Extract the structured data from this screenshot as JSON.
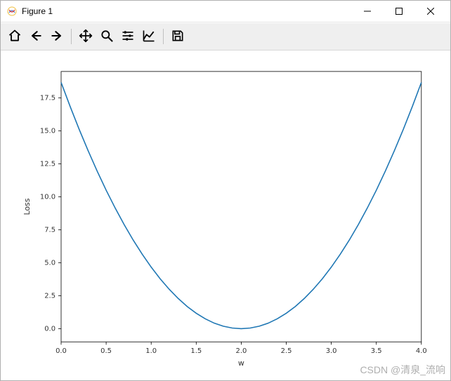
{
  "window": {
    "title": "Figure 1"
  },
  "toolbar": {
    "home": "Home",
    "back": "Back",
    "forward": "Forward",
    "pan": "Pan",
    "zoom": "Zoom",
    "subplots": "Configure subplots",
    "edit": "Edit axis",
    "save": "Save"
  },
  "watermark": "CSDN @清泉_流响",
  "chart_data": {
    "type": "line",
    "xlabel": "w",
    "ylabel": "Loss",
    "title": "",
    "xlim": [
      0.0,
      4.0
    ],
    "ylim": [
      -1.0,
      19.5
    ],
    "xticks": [
      0.0,
      0.5,
      1.0,
      1.5,
      2.0,
      2.5,
      3.0,
      3.5,
      4.0
    ],
    "yticks": [
      0.0,
      2.5,
      5.0,
      7.5,
      10.0,
      12.5,
      15.0,
      17.5
    ],
    "series": [
      {
        "name": "loss",
        "color": "#1f77b4",
        "x": [
          0.0,
          0.1,
          0.2,
          0.3,
          0.4,
          0.5,
          0.6,
          0.7,
          0.8,
          0.9,
          1.0,
          1.1,
          1.2,
          1.3,
          1.4,
          1.5,
          1.6,
          1.7,
          1.8,
          1.9,
          2.0,
          2.1,
          2.2,
          2.3,
          2.4,
          2.5,
          2.6,
          2.7,
          2.8,
          2.9,
          3.0,
          3.1,
          3.2,
          3.3,
          3.4,
          3.5,
          3.6,
          3.7,
          3.8,
          3.9,
          4.0
        ],
        "y": [
          18.67,
          16.85,
          15.12,
          13.49,
          11.95,
          10.5,
          9.15,
          7.89,
          6.72,
          5.65,
          4.67,
          3.78,
          2.99,
          2.29,
          1.68,
          1.17,
          0.75,
          0.42,
          0.19,
          0.05,
          0.0,
          0.05,
          0.19,
          0.42,
          0.75,
          1.17,
          1.68,
          2.29,
          2.99,
          3.78,
          4.67,
          5.65,
          6.72,
          7.89,
          9.15,
          10.5,
          11.95,
          13.49,
          15.12,
          16.85,
          18.67
        ]
      }
    ]
  }
}
